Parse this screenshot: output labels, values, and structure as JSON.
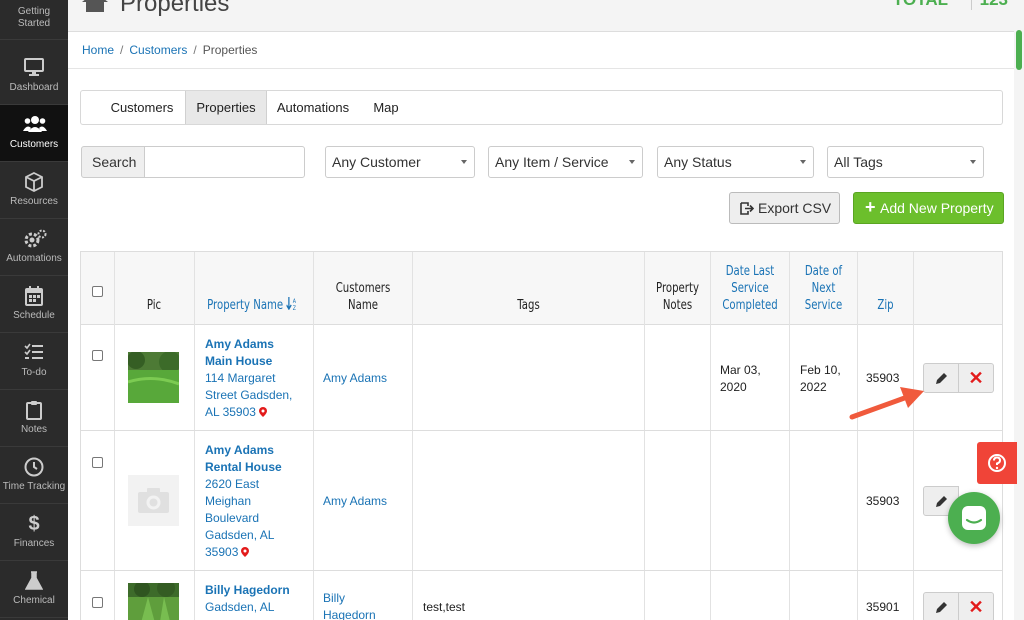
{
  "header": {
    "title": "Properties",
    "total_label": "TOTAL",
    "total_count": "123"
  },
  "sidebar": {
    "items": [
      {
        "label": "Getting Started",
        "icon": "getting-started-icon"
      },
      {
        "label": "Dashboard",
        "icon": "monitor-icon"
      },
      {
        "label": "Customers",
        "icon": "users-icon",
        "active": true
      },
      {
        "label": "Resources",
        "icon": "cube-icon"
      },
      {
        "label": "Automations",
        "icon": "gears-icon"
      },
      {
        "label": "Schedule",
        "icon": "calendar-icon"
      },
      {
        "label": "To-do",
        "icon": "checklist-icon"
      },
      {
        "label": "Notes",
        "icon": "clipboard-icon"
      },
      {
        "label": "Time Tracking",
        "icon": "clock-icon"
      },
      {
        "label": "Finances",
        "icon": "dollar-icon"
      },
      {
        "label": "Chemical",
        "icon": "flask-icon"
      }
    ]
  },
  "breadcrumb": {
    "home": "Home",
    "customers": "Customers",
    "current": "Properties",
    "sep": "/"
  },
  "tabs": [
    {
      "label": "Customers"
    },
    {
      "label": "Properties",
      "active": true
    },
    {
      "label": "Automations"
    },
    {
      "label": "Map"
    }
  ],
  "filters": {
    "search_label": "Search",
    "search_value": "",
    "customer": "Any Customer",
    "item_service": "Any Item / Service",
    "status": "Any Status",
    "tags": "All Tags"
  },
  "actions": {
    "export": "Export CSV",
    "add": "Add New Property",
    "add_prefix": "+"
  },
  "table": {
    "headers": {
      "pic": "Pic",
      "property_name": "Property Name",
      "customers_name_1": "Customers",
      "customers_name_2": "Name",
      "tags": "Tags",
      "notes_1": "Property",
      "notes_2": "Notes",
      "last_1": "Date Last",
      "last_2": "Service",
      "last_3": "Completed",
      "next_1": "Date of",
      "next_2": "Next",
      "next_3": "Service",
      "zip": "Zip"
    },
    "rows": [
      {
        "name_1": "Amy Adams",
        "name_2": "Main House",
        "addr": [
          "114 Margaret",
          "Street Gadsden,",
          "AL 35903"
        ],
        "customer": "Amy Adams",
        "tags": "",
        "last_1": "Mar 03,",
        "last_2": "2020",
        "next_1": "Feb 10,",
        "next_2": "2022",
        "zip": "35903",
        "delete": "✕"
      },
      {
        "name_1": "Amy Adams",
        "name_2": "Rental House",
        "addr": [
          "2620 East",
          "Meighan",
          "Boulevard",
          "Gadsden, AL",
          "35903"
        ],
        "customer": "Amy Adams",
        "tags": "",
        "zip": "35903"
      },
      {
        "name_1": "Billy Hagedorn",
        "addr": [
          "Gadsden, AL"
        ],
        "customer_1": "Billy",
        "customer_2": "Hagedorn",
        "tags": "test,test",
        "zip": "35901",
        "delete": "✕"
      }
    ]
  },
  "colors": {
    "accent_green": "#6cbf2c",
    "link_blue": "#1a73b5",
    "danger_red": "#e31b1b",
    "sidebar_bg": "#2b2b2b"
  }
}
